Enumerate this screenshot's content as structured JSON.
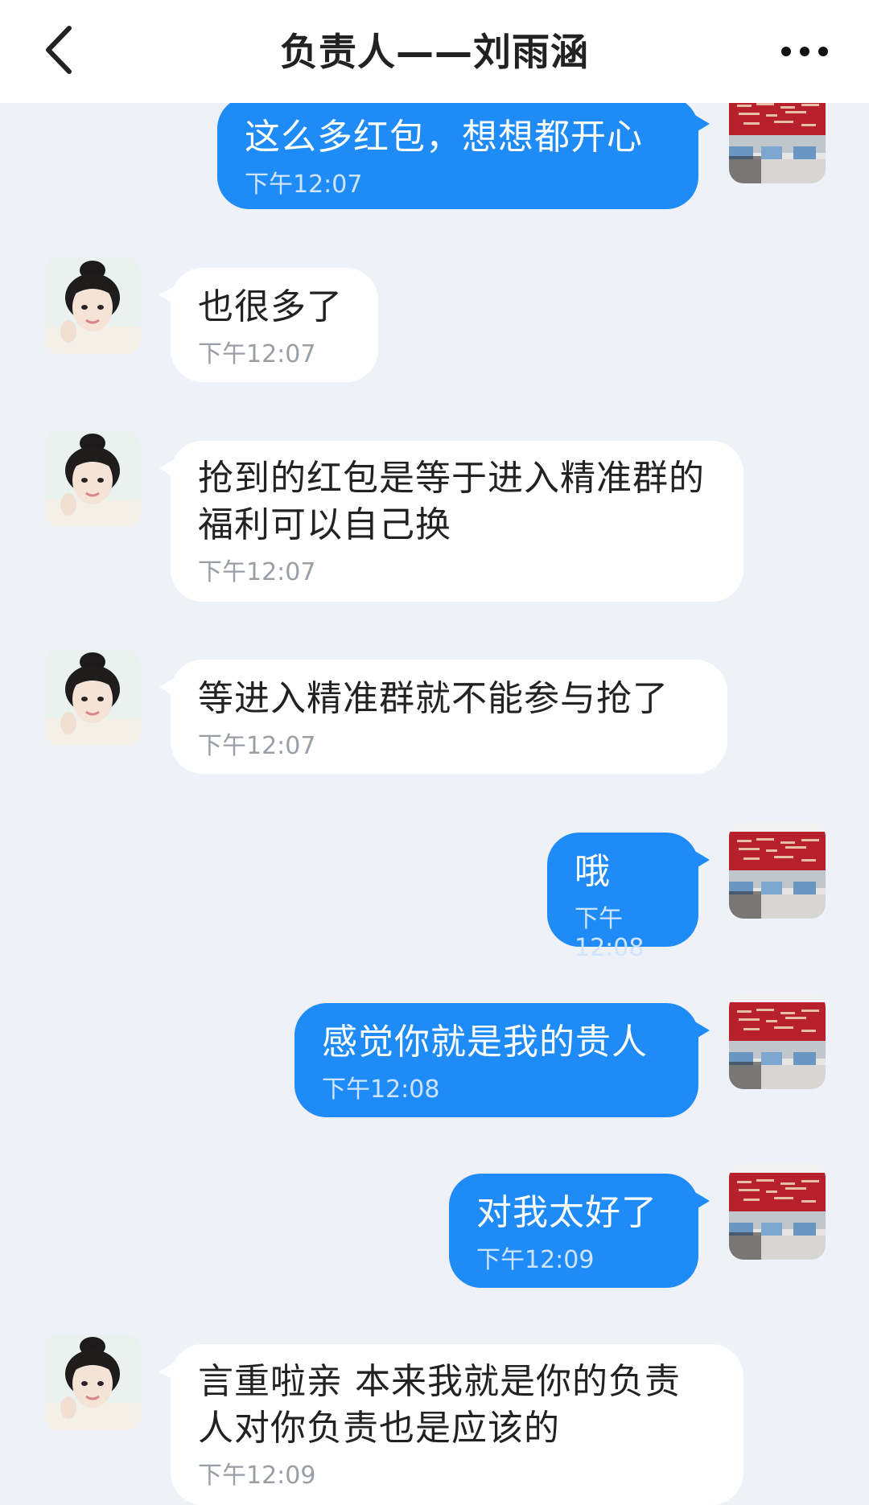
{
  "header": {
    "title": "负责人——刘雨涵",
    "back_icon": "chevron-left-icon",
    "more_icon": "more-horizontal-icon"
  },
  "colors": {
    "outgoing_bubble": "#1f8bf7",
    "incoming_bubble": "#ffffff",
    "background": "#eef1f7"
  },
  "messages": [
    {
      "side": "out",
      "text": "这么多红包，想想都开心",
      "time": "下午12:07"
    },
    {
      "side": "in",
      "text": "也很多了",
      "time": "下午12:07"
    },
    {
      "side": "in",
      "text": "抢到的红包是等于进入精准群的福利可以自己换",
      "time": "下午12:07"
    },
    {
      "side": "in",
      "text": "等进入精准群就不能参与抢了",
      "time": "下午12:07"
    },
    {
      "side": "out",
      "text": "哦",
      "time": "下午12:08"
    },
    {
      "side": "out",
      "text": "感觉你就是我的贵人",
      "time": "下午12:08"
    },
    {
      "side": "out",
      "text": "对我太好了",
      "time": "下午12:09"
    },
    {
      "side": "in",
      "text": "言重啦亲 本来我就是你的负责人对你负责也是应该的",
      "time": "下午12:09"
    }
  ]
}
